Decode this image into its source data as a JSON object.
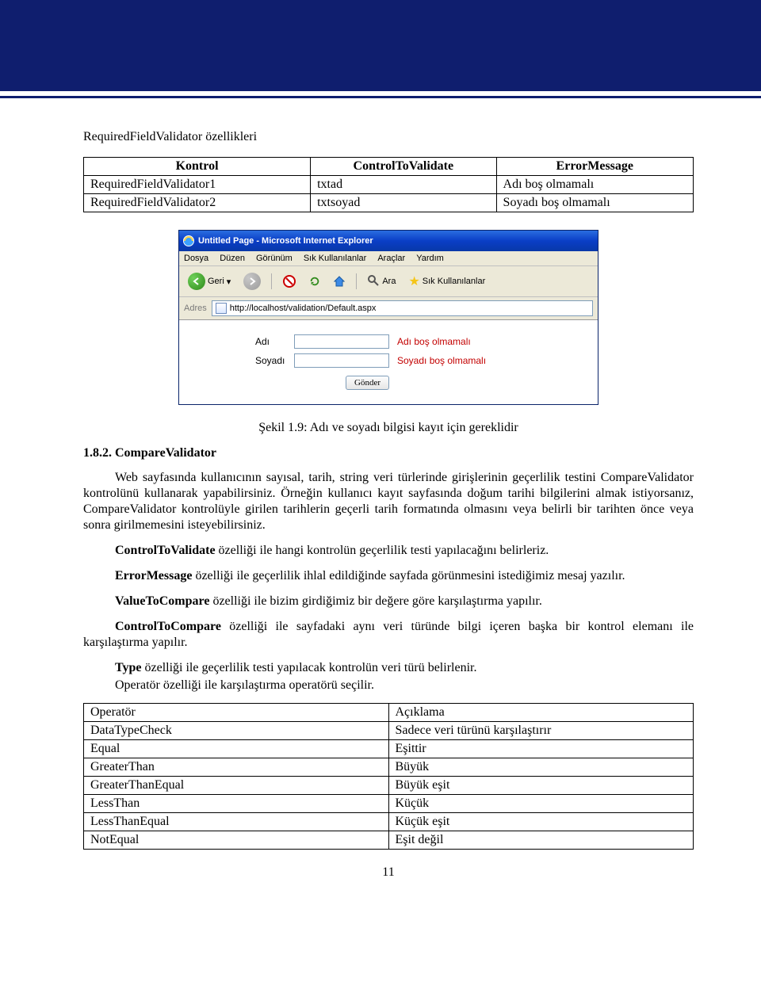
{
  "section_title": "RequiredFieldValidator özellikleri",
  "table1": {
    "headers": [
      "Kontrol",
      "ControlToValidate",
      "ErrorMessage"
    ],
    "rows": [
      [
        "RequiredFieldValidator1",
        "txtad",
        "Adı boş olmamalı"
      ],
      [
        "RequiredFieldValidator2",
        "txtsoyad",
        "Soyadı boş olmamalı"
      ]
    ]
  },
  "browser": {
    "title": "Untitled Page - Microsoft Internet Explorer",
    "menu": [
      "Dosya",
      "Düzen",
      "Görünüm",
      "Sık Kullanılanlar",
      "Araçlar",
      "Yardım"
    ],
    "toolbar": {
      "back": "Geri",
      "search": "Ara",
      "fav": "Sık Kullanılanlar"
    },
    "address": {
      "label": "Adres",
      "url": "http://localhost/validation/Default.aspx"
    },
    "form": {
      "row1_label": "Adı",
      "row1_error": "Adı boş olmamalı",
      "row2_label": "Soyadı",
      "row2_error": "Soyadı boş olmamalı",
      "submit": "Gönder"
    }
  },
  "caption": "Şekil 1.9: Adı ve soyadı bilgisi kayıt için gereklidir",
  "subheading": "1.8.2. CompareValidator",
  "p1": "Web sayfasında kullanıcının sayısal, tarih, string veri türlerinde girişlerinin geçerlilik testini CompareValidator kontrolünü kullanarak yapabilirsiniz. Örneğin kullanıcı kayıt sayfasında doğum tarihi bilgilerini almak istiyorsanız, CompareValidator kontrolüyle girilen tarihlerin geçerli tarih formatında olmasını veya belirli bir tarihten önce veya sonra girilmemesini isteyebilirsiniz.",
  "p2_bold": "ControlToValidate",
  "p2_rest": " özelliği ile hangi kontrolün geçerlilik testi yapılacağını belirleriz.",
  "p3_bold": "ErrorMessage",
  "p3_rest": " özelliği ile geçerlilik ihlal edildiğinde sayfada görünmesini istediğimiz mesaj yazılır.",
  "p4_bold": "ValueToCompare",
  "p4_rest": " özelliği ile bizim girdiğimiz bir değere göre karşılaştırma yapılır.",
  "p5_bold": "ControlToCompare",
  "p5_rest": " özelliği ile sayfadaki aynı veri türünde bilgi içeren başka bir kontrol elemanı ile karşılaştırma yapılır.",
  "p6_bold": "Type",
  "p6_rest": " özelliği ile geçerlilik testi yapılacak kontrolün veri türü belirlenir.",
  "p7": "Operatör özelliği ile karşılaştırma operatörü seçilir.",
  "table2": {
    "headers": [
      "Operatör",
      "Açıklama"
    ],
    "rows": [
      [
        "DataTypeCheck",
        "Sadece veri türünü karşılaştırır"
      ],
      [
        "Equal",
        "Eşittir"
      ],
      [
        "GreaterThan",
        "Büyük"
      ],
      [
        "GreaterThanEqual",
        "Büyük eşit"
      ],
      [
        "LessThan",
        "Küçük"
      ],
      [
        "LessThanEqual",
        "Küçük eşit"
      ],
      [
        "NotEqual",
        "Eşit değil"
      ]
    ]
  },
  "page_num": "11"
}
